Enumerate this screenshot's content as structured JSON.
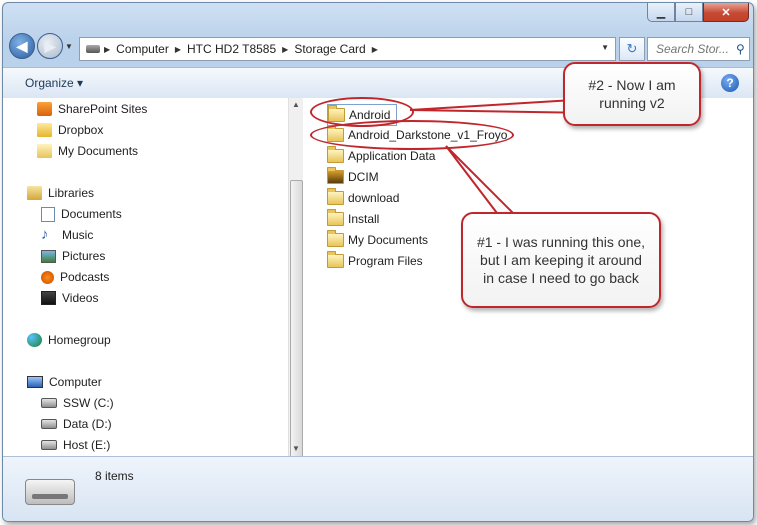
{
  "address": {
    "path": [
      "Computer",
      "HTC HD2 T8585",
      "Storage Card"
    ]
  },
  "search": {
    "placeholder": "Search Stor..."
  },
  "toolbar": {
    "organize_label": "Organize ▾",
    "help_label": "?"
  },
  "nav": {
    "favorites": [
      "SharePoint Sites",
      "Dropbox",
      "My Documents"
    ],
    "libraries_label": "Libraries",
    "libraries": [
      "Documents",
      "Music",
      "Pictures",
      "Podcasts",
      "Videos"
    ],
    "homegroup_label": "Homegroup",
    "computer_label": "Computer",
    "drives": [
      "SSW (C:)",
      "Data (D:)",
      "Host (E:)"
    ]
  },
  "files": [
    "Android",
    "Android_Darkstone_v1_Froyo",
    "Application Data",
    "DCIM",
    "download",
    "Install",
    "My Documents",
    "Program Files"
  ],
  "status": {
    "item_count": "8 items"
  },
  "annotations": {
    "callout_2": "#2 - Now I am running v2",
    "callout_1": "#1 - I was running this one, but I am keeping it around in case I need to go back"
  },
  "colors": {
    "callout_border": "#c0272d",
    "window_frame": "#b9d1ea"
  }
}
